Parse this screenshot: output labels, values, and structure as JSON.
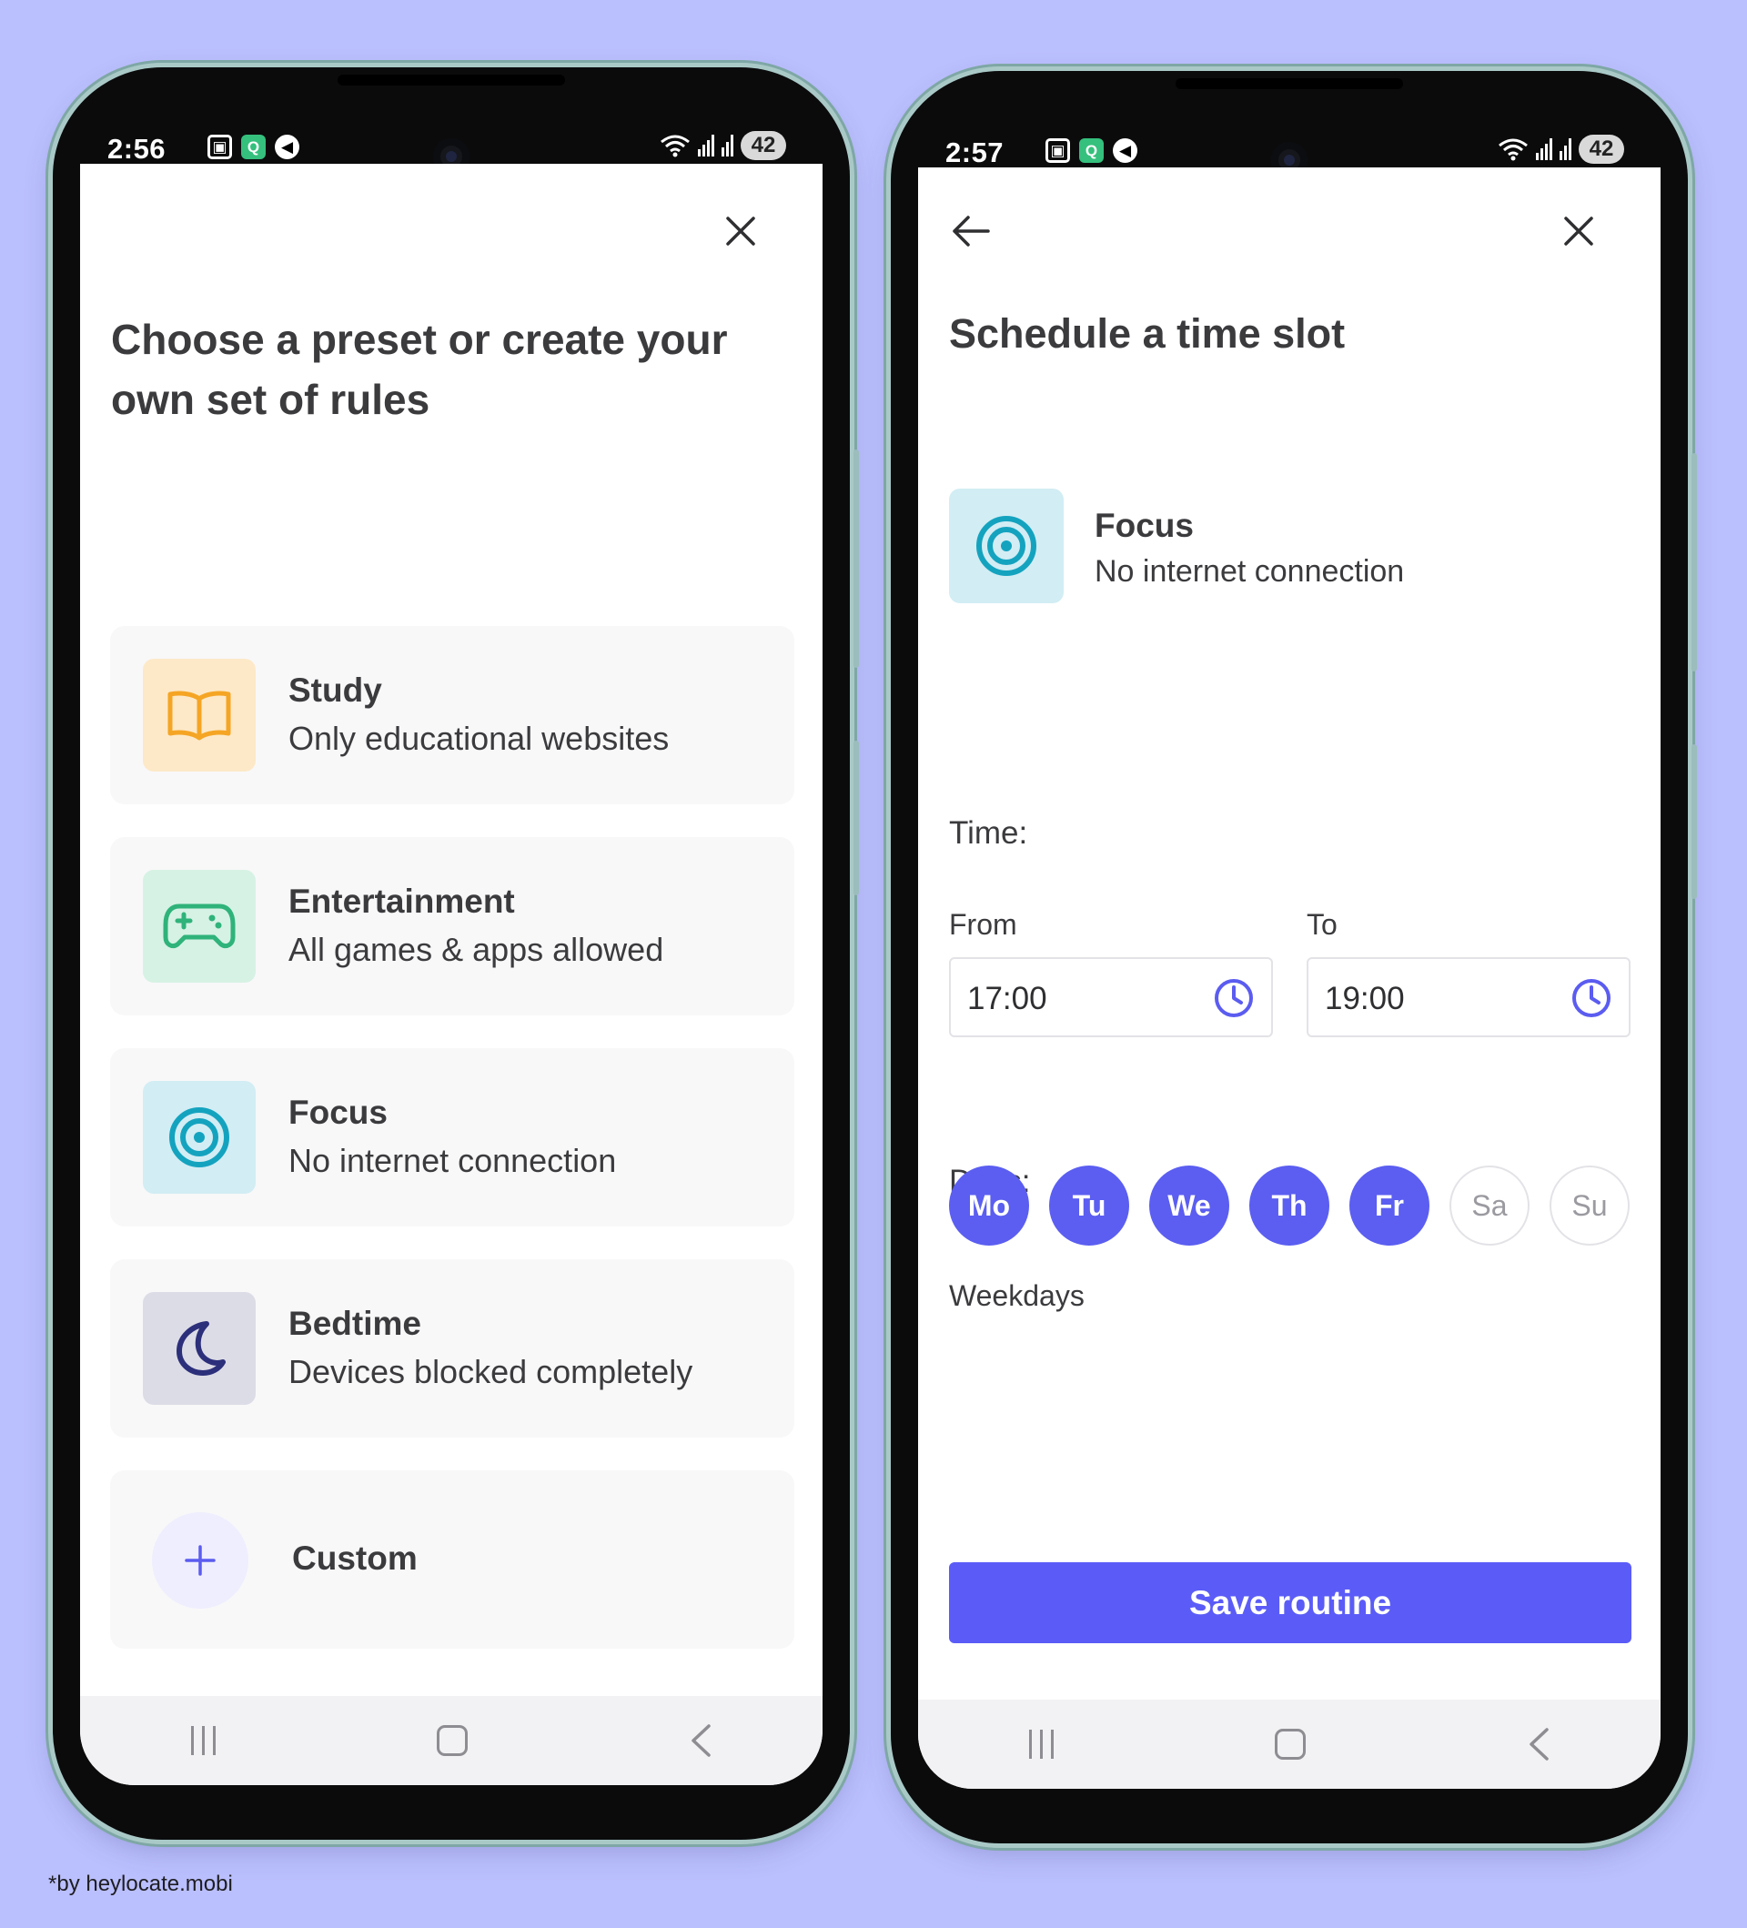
{
  "left_phone": {
    "status": {
      "time": "2:56",
      "battery": "42"
    },
    "title": "Choose a preset or create your own set of rules",
    "presets": [
      {
        "title": "Study",
        "subtitle": "Only educational websites",
        "icon": "book-icon",
        "icon_bg": "#fde9c8",
        "icon_color": "#f5a524"
      },
      {
        "title": "Entertainment",
        "subtitle": "All games & apps allowed",
        "icon": "gamepad-icon",
        "icon_bg": "#d6f2e4",
        "icon_color": "#2fb37a"
      },
      {
        "title": "Focus",
        "subtitle": "No internet connection",
        "icon": "target-icon",
        "icon_bg": "#d2edf4",
        "icon_color": "#14a3bf"
      },
      {
        "title": "Bedtime",
        "subtitle": "Devices blocked completely",
        "icon": "moon-icon",
        "icon_bg": "#dcdce6",
        "icon_color": "#2c2f7a"
      }
    ],
    "custom": {
      "label": "Custom",
      "icon": "plus-icon"
    }
  },
  "right_phone": {
    "status": {
      "time": "2:57",
      "battery": "42"
    },
    "title": "Schedule a time slot",
    "preset": {
      "title": "Focus",
      "subtitle": "No internet connection",
      "icon": "target-icon"
    },
    "time_label": "Time:",
    "from": {
      "label": "From",
      "value": "17:00"
    },
    "to": {
      "label": "To",
      "value": "19:00"
    },
    "days_label": "Days:",
    "days": [
      {
        "label": "Mo",
        "selected": true
      },
      {
        "label": "Tu",
        "selected": true
      },
      {
        "label": "We",
        "selected": true
      },
      {
        "label": "Th",
        "selected": true
      },
      {
        "label": "Fr",
        "selected": true
      },
      {
        "label": "Sa",
        "selected": false
      },
      {
        "label": "Su",
        "selected": false
      }
    ],
    "days_caption": "Weekdays",
    "save_label": "Save routine"
  },
  "colors": {
    "background": "#babffd",
    "accent": "#5b5cf7"
  },
  "credit": "*by heylocate.mobi"
}
